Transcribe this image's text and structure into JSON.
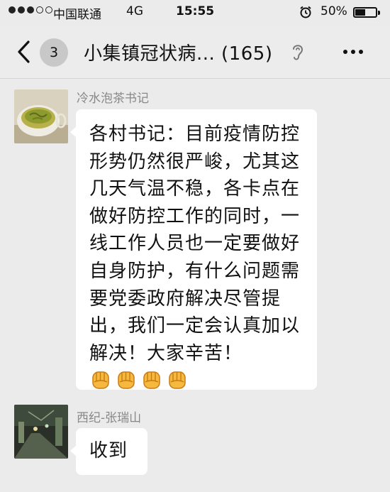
{
  "status_bar": {
    "signal_dots": [
      true,
      true,
      true,
      false,
      false
    ],
    "carrier": "中国联通",
    "network": "4G",
    "time": "15:55",
    "alarm_icon": "alarm-clock-icon",
    "battery_percent": "50%",
    "battery_level": 0.5
  },
  "nav": {
    "back_icon": "chevron-left-icon",
    "unread_count": "3",
    "title": "小集镇冠状病... (165)",
    "ear_icon": "ear-icon",
    "more_icon": "more-dots-icon"
  },
  "messages": [
    {
      "sender": "冷水泡茶书记",
      "avatar": "tea-cup-avatar",
      "text": "各村书记：目前疫情防控形势仍然很严峻，尤其这几天气温不稳，各卡点在做好防控工作的同时，一线工作人员也一定要做好自身防护，有什么问题需要党委政府解决尽管提出，我们一定会认真加以解决！大家辛苦！",
      "emojis": [
        "fist-emoji",
        "fist-emoji",
        "fist-emoji",
        "fist-emoji"
      ]
    },
    {
      "sender": "西纪-张瑞山",
      "avatar": "night-street-avatar",
      "text": "收到"
    }
  ],
  "colors": {
    "background": "#ebebeb",
    "bubble": "#ffffff",
    "sender_name": "#888888",
    "badge": "#c8c8c8",
    "fist": "#f5b93e"
  }
}
